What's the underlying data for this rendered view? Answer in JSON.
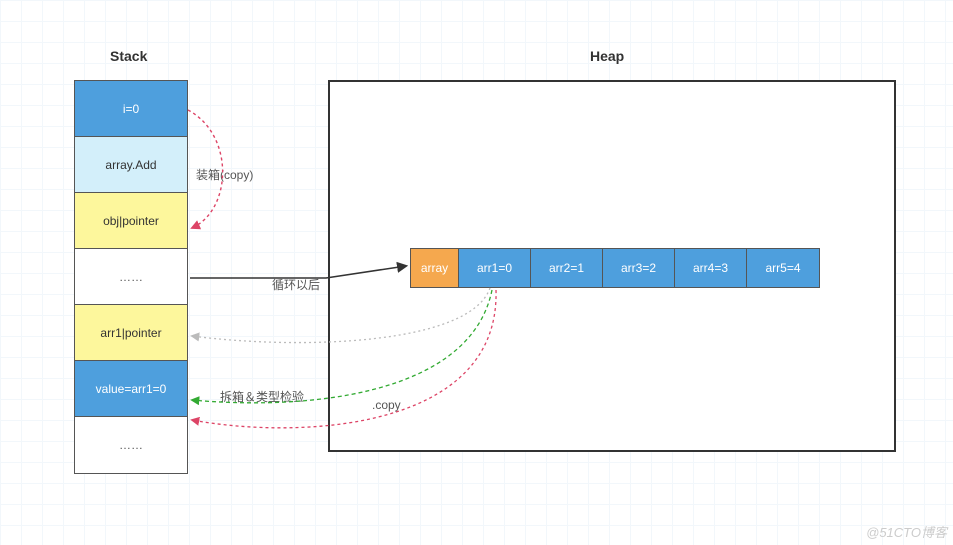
{
  "titles": {
    "stack": "Stack",
    "heap": "Heap"
  },
  "stack": {
    "cells": [
      {
        "text": "i=0"
      },
      {
        "text": "array.Add"
      },
      {
        "text": "obj|pointer"
      },
      {
        "text": "……"
      },
      {
        "text": "arr1|pointer"
      },
      {
        "text": "value=arr1=0"
      },
      {
        "text": "……"
      }
    ]
  },
  "heap": {
    "head": "array",
    "items": [
      {
        "text": "arr1=0"
      },
      {
        "text": "arr2=1"
      },
      {
        "text": "arr3=2"
      },
      {
        "text": "arr4=3"
      },
      {
        "text": "arr5=4"
      }
    ]
  },
  "labels": {
    "boxing": "装箱(copy)",
    "afterLoop": "循环以后",
    "unboxing": "拆箱＆类型检验",
    "copy": ".copy"
  },
  "watermark": "@51CTO博客",
  "chart_data": {
    "type": "diagram",
    "title": "Stack vs Heap (boxing / unboxing illustration)",
    "stack_frames": [
      "i=0",
      "array.Add",
      "obj|pointer",
      "……",
      "arr1|pointer",
      "value=arr1=0",
      "……"
    ],
    "heap_object": {
      "name": "array",
      "elements": [
        "arr1=0",
        "arr2=1",
        "arr3=2",
        "arr4=3",
        "arr5=4"
      ]
    },
    "arrows": [
      {
        "from": "i=0",
        "to": "obj|pointer",
        "label": "装箱(copy)",
        "style": "dashed-red"
      },
      {
        "from": "obj|pointer / ……",
        "to": "heap.array",
        "label": "循环以后",
        "style": "solid-black"
      },
      {
        "from": "heap.arr1",
        "to": "arr1|pointer",
        "label": "",
        "style": "dotted-gray"
      },
      {
        "from": "heap.arr1",
        "to": "value=arr1=0",
        "label": "拆箱＆类型检验",
        "style": "dashed-green"
      },
      {
        "from": "heap.arr1",
        "to": "value=arr1=0",
        "label": ".copy",
        "style": "dashed-red"
      }
    ]
  }
}
